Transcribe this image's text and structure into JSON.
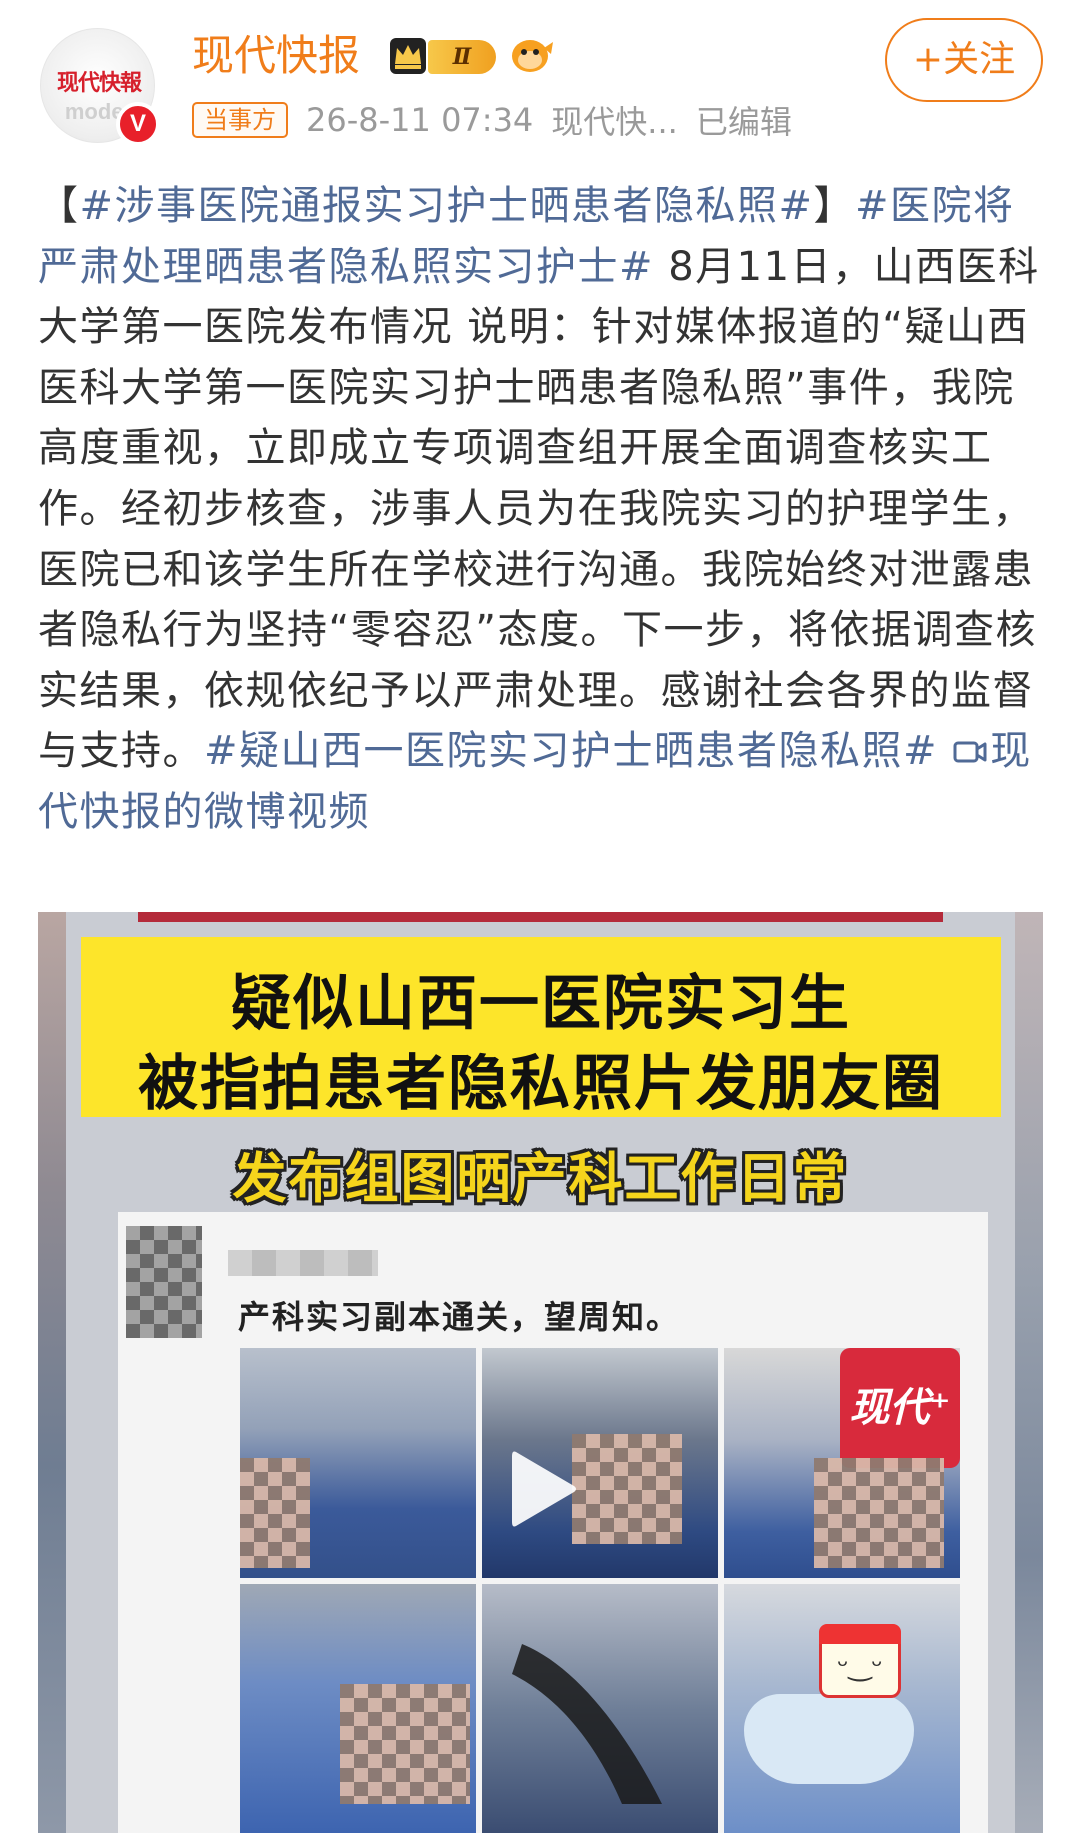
{
  "user": {
    "name": "现代快报",
    "avatar_logo": "现代快報",
    "avatar_sub": "moder",
    "verified_mark": "V",
    "level": "Ⅱ",
    "follow_label": "+关注"
  },
  "meta": {
    "tag": "当事方",
    "time": "26-8-11 07:34",
    "source": "现代快...",
    "edited": "已编辑"
  },
  "post": {
    "bracket_open": "【",
    "topic1": "#涉事医院通报实习护士晒患者隐私照#",
    "bracket_close": "】",
    "topic2": "#医院将严肃处理晒患者隐私照实习护士#",
    "body": " 8月11日，山西医科大学第一医院发布情况 说明：针对媒体报道的“疑山西医科大学第一医院实习护士晒患者隐私照”事件，我院高度重视，立即成立专项调查组开展全面调查核实工作。经初步核查，涉事人员为在我院实习的护理学生，医院已和该学生所在学校进行沟通。我院始终对泄露患者隐私行为坚持“零容忍”态度。下一步，将依据调查核实结果，依规依纪予以严肃处理。感谢社会各界的监督与支持。",
    "topic3": "#疑山西一医院实习护士晒患者隐私照#",
    "video_link": "现代快报的微博视频"
  },
  "video": {
    "banner_line1": "疑似山西一医院实习生",
    "banner_line2": "被指拍患者隐私照片发朋友圈",
    "subtitle": "发布组图晒产科工作日常",
    "moment_text": "产科实习副本通关，望周知。",
    "watermark": "现代⁺",
    "mask_emoji": "ᵕ‿ᵕ"
  },
  "colors": {
    "accent_orange": "#f07d1a",
    "link_blue": "#506a96",
    "banner_yellow": "#fde52a",
    "verified_red": "#e8202a"
  },
  "icons": [
    "crown-icon",
    "fish-icon",
    "verified-icon",
    "video-link-icon",
    "play-icon"
  ]
}
